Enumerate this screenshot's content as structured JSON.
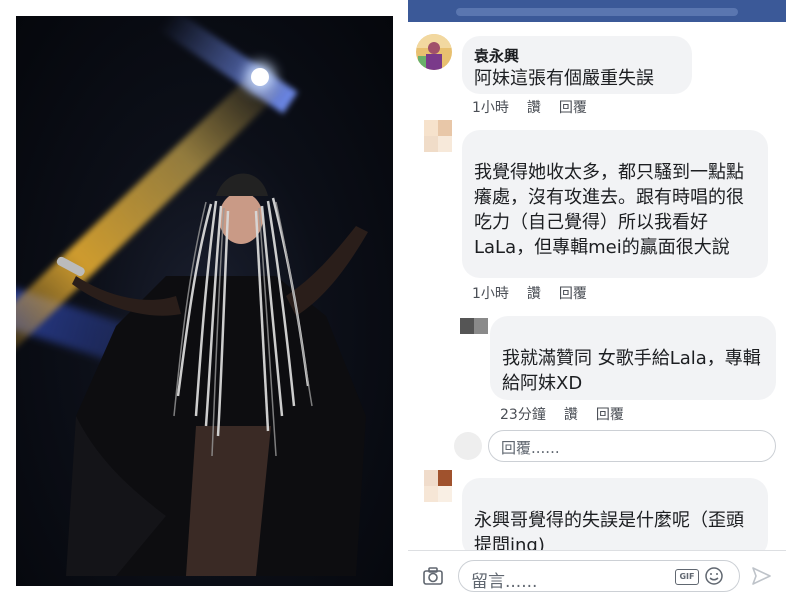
{
  "photo": {
    "icon": "concert-photo"
  },
  "comments": [
    {
      "author": "袁永興",
      "text": "阿妹這張有個嚴重失誤",
      "time": "1小時",
      "like": "讚",
      "reply": "回覆"
    },
    {
      "author": "",
      "text": "我覺得她收太多，都只騷到一點點癢處，沒有攻進去。跟有時唱的很吃力（自己覺得）所以我看好LaLa，但專輯mei的贏面很大說",
      "time": "1小時",
      "like": "讚",
      "reply": "回覆"
    },
    {
      "author": "",
      "text": "我就滿贊同 女歌手給Lala，專輯給阿妹XD",
      "time": "23分鐘",
      "like": "讚",
      "reply": "回覆"
    },
    {
      "author": "",
      "text": "永興哥覺得的失誤是什麼呢（歪頭提問ing)"
    }
  ],
  "reply_placeholder": "回覆......",
  "composer": {
    "placeholder": "留言......",
    "gif_label": "GIF"
  }
}
